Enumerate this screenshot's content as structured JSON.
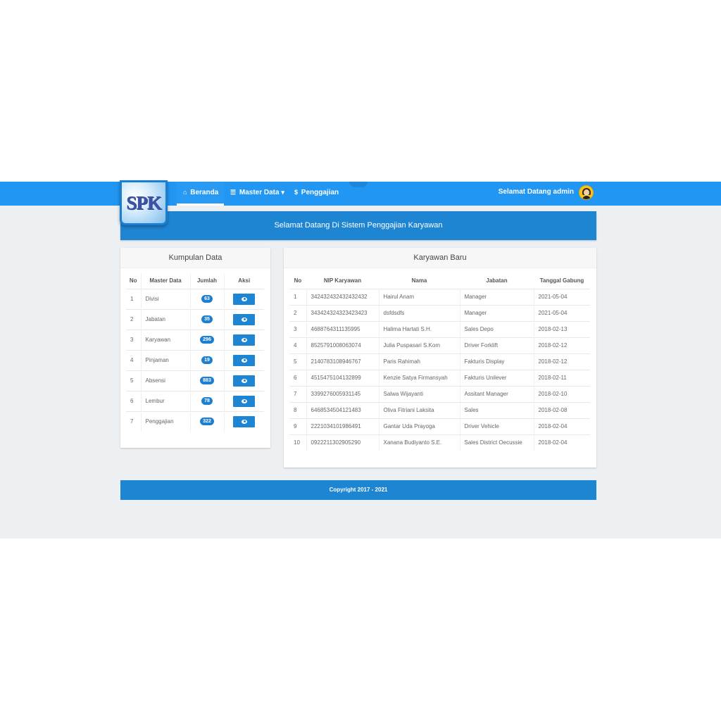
{
  "logo": {
    "text": "SPK"
  },
  "nav": {
    "home": "Beranda",
    "master": "Master Data",
    "payroll": "Penggajian",
    "welcome": "Selamat Datang admin"
  },
  "banner": "Selamat Datang Di Sistem Penggajian Karyawan",
  "left": {
    "title": "Kumpulan Data",
    "headers": [
      "No",
      "Master Data",
      "Jumlah",
      "Aksi"
    ],
    "rows": [
      {
        "no": "1",
        "name": "Divisi",
        "count": "63"
      },
      {
        "no": "2",
        "name": "Jabatan",
        "count": "35"
      },
      {
        "no": "3",
        "name": "Karyawan",
        "count": "296"
      },
      {
        "no": "4",
        "name": "Pinjaman",
        "count": "19"
      },
      {
        "no": "5",
        "name": "Absensi",
        "count": "883"
      },
      {
        "no": "6",
        "name": "Lembur",
        "count": "78"
      },
      {
        "no": "7",
        "name": "Penggajian",
        "count": "322"
      }
    ]
  },
  "right": {
    "title": "Karyawan Baru",
    "headers": [
      "No",
      "NIP Karyawan",
      "Nama",
      "Jabatan",
      "Tanggal Gabung"
    ],
    "rows": [
      [
        "1",
        "342432432432432432",
        "Hairul Anam",
        "Manager",
        "2021-05-04"
      ],
      [
        "2",
        "343424324323423423",
        "dsfdsdfs",
        "Manager",
        "2021-05-04"
      ],
      [
        "3",
        "4688764311135995",
        "Halima Hartati S.H.",
        "Sales Depo",
        "2018-02-13"
      ],
      [
        "4",
        "8525791008063074",
        "Julia Puspasari S.Kom",
        "Driver Forklift",
        "2018-02-12"
      ],
      [
        "5",
        "2140783108946767",
        "Paris Rahimah",
        "Fakturis Display",
        "2018-02-12"
      ],
      [
        "6",
        "4515475104132899",
        "Kenzie Satya Firmansyah",
        "Fakturis Unilever",
        "2018-02-11"
      ],
      [
        "7",
        "3399276005931145",
        "Salwa Wijayanti",
        "Assitant Manager",
        "2018-02-10"
      ],
      [
        "8",
        "6468534504121483",
        "Oliva Fitriani Laksita",
        "Sales",
        "2018-02-08"
      ],
      [
        "9",
        "2221034101986491",
        "Gantar Uda Prayoga",
        "Driver Vehicle",
        "2018-02-04"
      ],
      [
        "10",
        "0922211302905290",
        "Xanana Budiyanto S.E.",
        "Sales District Oecussie",
        "2018-02-04"
      ]
    ]
  },
  "footer": "Copyright 2017 - 2021"
}
